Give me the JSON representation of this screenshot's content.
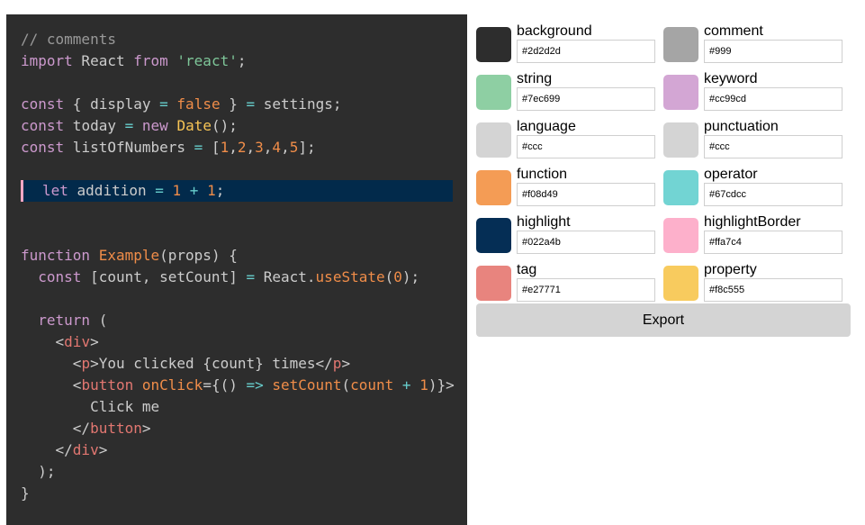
{
  "theme": {
    "background": "#2d2d2d",
    "comment": "#999",
    "string": "#7ec699",
    "keyword": "#cc99cd",
    "language": "#ccc",
    "punctuation": "#ccc",
    "function": "#f08d49",
    "operator": "#67cdcc",
    "highlight": "#022a4b",
    "highlightBorder": "#ffa7c4",
    "tag": "#e27771",
    "property": "#f8c555"
  },
  "code_lines": [
    {
      "tokens": [
        {
          "t": "// comments",
          "c": "comment"
        }
      ]
    },
    {
      "tokens": [
        {
          "t": "import",
          "c": "keyword"
        },
        {
          "t": " React ",
          "c": "language"
        },
        {
          "t": "from",
          "c": "keyword"
        },
        {
          "t": " ",
          "c": "language"
        },
        {
          "t": "'react'",
          "c": "string"
        },
        {
          "t": ";",
          "c": "punctuation"
        }
      ]
    },
    {
      "tokens": []
    },
    {
      "tokens": [
        {
          "t": "const",
          "c": "keyword"
        },
        {
          "t": " { display ",
          "c": "language"
        },
        {
          "t": "=",
          "c": "operator"
        },
        {
          "t": " ",
          "c": "language"
        },
        {
          "t": "false",
          "c": "function"
        },
        {
          "t": " } ",
          "c": "language"
        },
        {
          "t": "=",
          "c": "operator"
        },
        {
          "t": " settings;",
          "c": "language"
        }
      ]
    },
    {
      "tokens": [
        {
          "t": "const",
          "c": "keyword"
        },
        {
          "t": " today ",
          "c": "language"
        },
        {
          "t": "=",
          "c": "operator"
        },
        {
          "t": " ",
          "c": "language"
        },
        {
          "t": "new",
          "c": "keyword"
        },
        {
          "t": " ",
          "c": "language"
        },
        {
          "t": "Date",
          "c": "property"
        },
        {
          "t": "();",
          "c": "language"
        }
      ]
    },
    {
      "tokens": [
        {
          "t": "const",
          "c": "keyword"
        },
        {
          "t": " listOfNumbers ",
          "c": "language"
        },
        {
          "t": "=",
          "c": "operator"
        },
        {
          "t": " [",
          "c": "language"
        },
        {
          "t": "1",
          "c": "function"
        },
        {
          "t": ",",
          "c": "language"
        },
        {
          "t": "2",
          "c": "function"
        },
        {
          "t": ",",
          "c": "language"
        },
        {
          "t": "3",
          "c": "function"
        },
        {
          "t": ",",
          "c": "language"
        },
        {
          "t": "4",
          "c": "function"
        },
        {
          "t": ",",
          "c": "language"
        },
        {
          "t": "5",
          "c": "function"
        },
        {
          "t": "];",
          "c": "language"
        }
      ]
    },
    {
      "tokens": []
    },
    {
      "highlight": true,
      "tokens": [
        {
          "t": "let",
          "c": "keyword"
        },
        {
          "t": " addition ",
          "c": "language"
        },
        {
          "t": "=",
          "c": "operator"
        },
        {
          "t": " ",
          "c": "language"
        },
        {
          "t": "1",
          "c": "function"
        },
        {
          "t": " ",
          "c": "language"
        },
        {
          "t": "+",
          "c": "operator"
        },
        {
          "t": " ",
          "c": "language"
        },
        {
          "t": "1",
          "c": "function"
        },
        {
          "t": ";",
          "c": "language"
        }
      ]
    },
    {
      "tokens": []
    },
    {
      "tokens": []
    },
    {
      "tokens": [
        {
          "t": "function",
          "c": "keyword"
        },
        {
          "t": " ",
          "c": "language"
        },
        {
          "t": "Example",
          "c": "function"
        },
        {
          "t": "(props) {",
          "c": "language"
        }
      ]
    },
    {
      "tokens": [
        {
          "t": "  ",
          "c": "language"
        },
        {
          "t": "const",
          "c": "keyword"
        },
        {
          "t": " [count, setCount] ",
          "c": "language"
        },
        {
          "t": "=",
          "c": "operator"
        },
        {
          "t": " React.",
          "c": "language"
        },
        {
          "t": "useState",
          "c": "function"
        },
        {
          "t": "(",
          "c": "language"
        },
        {
          "t": "0",
          "c": "function"
        },
        {
          "t": ");",
          "c": "language"
        }
      ]
    },
    {
      "tokens": []
    },
    {
      "tokens": [
        {
          "t": "  ",
          "c": "language"
        },
        {
          "t": "return",
          "c": "keyword"
        },
        {
          "t": " (",
          "c": "language"
        }
      ]
    },
    {
      "tokens": [
        {
          "t": "    <",
          "c": "language"
        },
        {
          "t": "div",
          "c": "tag"
        },
        {
          "t": ">",
          "c": "language"
        }
      ]
    },
    {
      "tokens": [
        {
          "t": "      <",
          "c": "language"
        },
        {
          "t": "p",
          "c": "tag"
        },
        {
          "t": ">You clicked {count} times</",
          "c": "language"
        },
        {
          "t": "p",
          "c": "tag"
        },
        {
          "t": ">",
          "c": "language"
        }
      ]
    },
    {
      "tokens": [
        {
          "t": "      <",
          "c": "language"
        },
        {
          "t": "button",
          "c": "tag"
        },
        {
          "t": " ",
          "c": "language"
        },
        {
          "t": "onClick",
          "c": "function"
        },
        {
          "t": "={() ",
          "c": "language"
        },
        {
          "t": "=>",
          "c": "operator"
        },
        {
          "t": " ",
          "c": "language"
        },
        {
          "t": "setCount",
          "c": "function"
        },
        {
          "t": "(",
          "c": "language"
        },
        {
          "t": "count",
          "c": "function"
        },
        {
          "t": " ",
          "c": "language"
        },
        {
          "t": "+",
          "c": "operator"
        },
        {
          "t": " ",
          "c": "language"
        },
        {
          "t": "1",
          "c": "function"
        },
        {
          "t": ")}>",
          "c": "language"
        }
      ]
    },
    {
      "tokens": [
        {
          "t": "        Click me",
          "c": "language"
        }
      ]
    },
    {
      "tokens": [
        {
          "t": "      </",
          "c": "language"
        },
        {
          "t": "button",
          "c": "tag"
        },
        {
          "t": ">",
          "c": "language"
        }
      ]
    },
    {
      "tokens": [
        {
          "t": "    </",
          "c": "language"
        },
        {
          "t": "div",
          "c": "tag"
        },
        {
          "t": ">",
          "c": "language"
        }
      ]
    },
    {
      "tokens": [
        {
          "t": "  );",
          "c": "language"
        }
      ]
    },
    {
      "tokens": [
        {
          "t": "}",
          "c": "language"
        }
      ]
    }
  ],
  "editor": {
    "entries": [
      {
        "label": "background",
        "value": "#2d2d2d",
        "color": "#2d2d2d"
      },
      {
        "label": "comment",
        "value": "#999",
        "color": "#a5a5a5"
      },
      {
        "label": "string",
        "value": "#7ec699",
        "color": "#8ecfa3"
      },
      {
        "label": "keyword",
        "value": "#cc99cd",
        "color": "#d3a6d4"
      },
      {
        "label": "language",
        "value": "#ccc",
        "color": "#d4d4d4"
      },
      {
        "label": "punctuation",
        "value": "#ccc",
        "color": "#d4d4d4"
      },
      {
        "label": "function",
        "value": "#f08d49",
        "color": "#f49c55"
      },
      {
        "label": "operator",
        "value": "#67cdcc",
        "color": "#72d4d3"
      },
      {
        "label": "highlight",
        "value": "#022a4b",
        "color": "#052e55"
      },
      {
        "label": "highlightBorder",
        "value": "#ffa7c4",
        "color": "#fdb0cb"
      },
      {
        "label": "tag",
        "value": "#e27771",
        "color": "#e8847e"
      },
      {
        "label": "property",
        "value": "#f8c555",
        "color": "#f8cb5e"
      }
    ],
    "export_label": "Export"
  }
}
